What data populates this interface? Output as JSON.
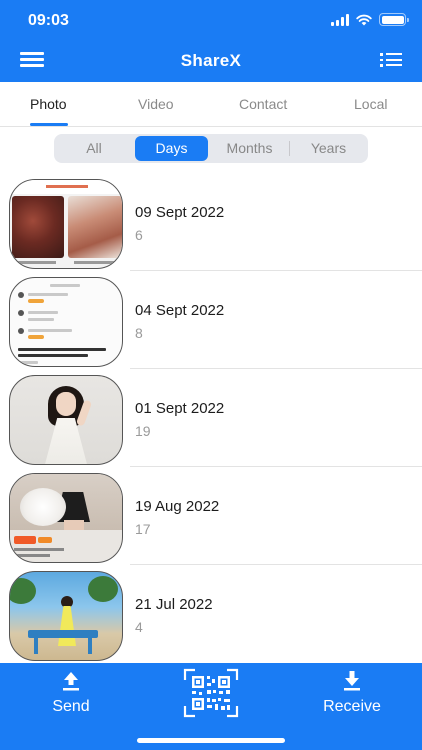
{
  "status": {
    "time": "09:03"
  },
  "header": {
    "title": "ShareX"
  },
  "tabs": [
    "Photo",
    "Video",
    "Contact",
    "Local"
  ],
  "segments": [
    "All",
    "Days",
    "Months",
    "Years"
  ],
  "items": [
    {
      "date": "09 Sept 2022",
      "count": "6"
    },
    {
      "date": "04 Sept 2022",
      "count": "8"
    },
    {
      "date": "01 Sept 2022",
      "count": "19"
    },
    {
      "date": "19 Aug 2022",
      "count": "17"
    },
    {
      "date": "21 Jul 2022",
      "count": "4"
    }
  ],
  "bottom": {
    "send": "Send",
    "receive": "Receive"
  },
  "colors": {
    "accent": "#1a7cf4"
  },
  "icons": {
    "menu": "hamburger-icon",
    "list": "list-icon",
    "send": "upload-icon",
    "receive": "download-icon",
    "qr": "qr-code-icon"
  }
}
